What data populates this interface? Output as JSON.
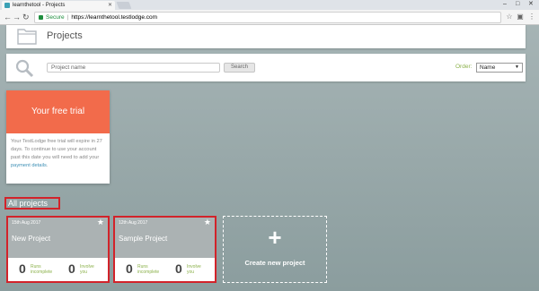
{
  "browser": {
    "tab_title": "learnthetool - Projects",
    "secure_label": "Secure",
    "url": "https://learnthetool.testlodge.com"
  },
  "header": {
    "title": "Projects",
    "icon": "folder-icon"
  },
  "search": {
    "placeholder": "Project name",
    "button_label": "Search",
    "order_label": "Order:",
    "order_value": "Name"
  },
  "trial": {
    "title": "Your free trial",
    "text": "Your TestLodge free trial will expire in 27 days. To continue to use your account past this date you will need to add your ",
    "link": "payment details",
    "text_end": "."
  },
  "section_title": "All projects",
  "projects": [
    {
      "date": "15th Aug 2017",
      "name": "New Project",
      "runs_count": "0",
      "runs_label": "Runs incomplete",
      "involve_count": "0",
      "involve_label": "Involve you"
    },
    {
      "date": "12th Aug 2017",
      "name": "Sample Project",
      "runs_count": "0",
      "runs_label": "Runs incomplete",
      "involve_count": "0",
      "involve_label": "Involve you"
    }
  ],
  "create": {
    "plus": "+",
    "label": "Create new project"
  },
  "colors": {
    "accent": "#8bb14a",
    "trial": "#f26b4b",
    "highlight": "#d2232a",
    "link": "#3c8fb5"
  }
}
